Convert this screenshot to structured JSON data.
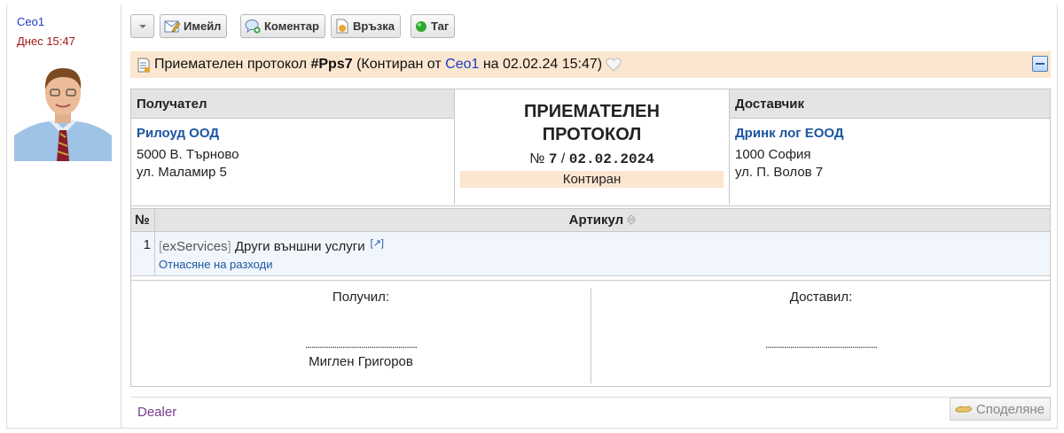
{
  "author": {
    "name": "Ceo1",
    "time": "Днес 15:47"
  },
  "toolbar": {
    "email_label": "Имейл",
    "comment_label": "Коментар",
    "link_label": "Връзка",
    "tag_label": "Таг"
  },
  "header": {
    "doc_type": "Приемателен протокол",
    "doc_id": "#Pps7",
    "state_prefix": "(Контиран от",
    "user": "Ceo1",
    "date_text": "на 02.02.24 15:47)"
  },
  "recipient": {
    "title": "Получател",
    "name": "Рилоуд ООД",
    "city": "5000 В. Търново",
    "street": "ул. Маламир 5"
  },
  "document": {
    "title": "ПРИЕМАТЕЛЕН ПРОТОКОЛ",
    "number_prefix": "№",
    "number": "7",
    "separator": "/",
    "date": "02.02.2024",
    "state": "Контиран"
  },
  "supplier": {
    "title": "Доставчик",
    "name": "Дринк лог ЕООД",
    "city": "1000 София",
    "street": "ул. П. Волов 7"
  },
  "items": {
    "col_no": "№",
    "col_article": "Артикул",
    "rows": [
      {
        "no": "1",
        "code": "exServices",
        "name": "Други външни услуги",
        "ext": "[↗]",
        "sub": "Отнасяне на разходи"
      }
    ]
  },
  "signatures": {
    "received_label": "Получил:",
    "received_dots": "......................................................",
    "received_name": "Миглен Григоров",
    "delivered_label": "Доставил:",
    "delivered_dots": "......................................................"
  },
  "footer": {
    "dealer": "Dealer",
    "share_label": "Споделяне"
  }
}
